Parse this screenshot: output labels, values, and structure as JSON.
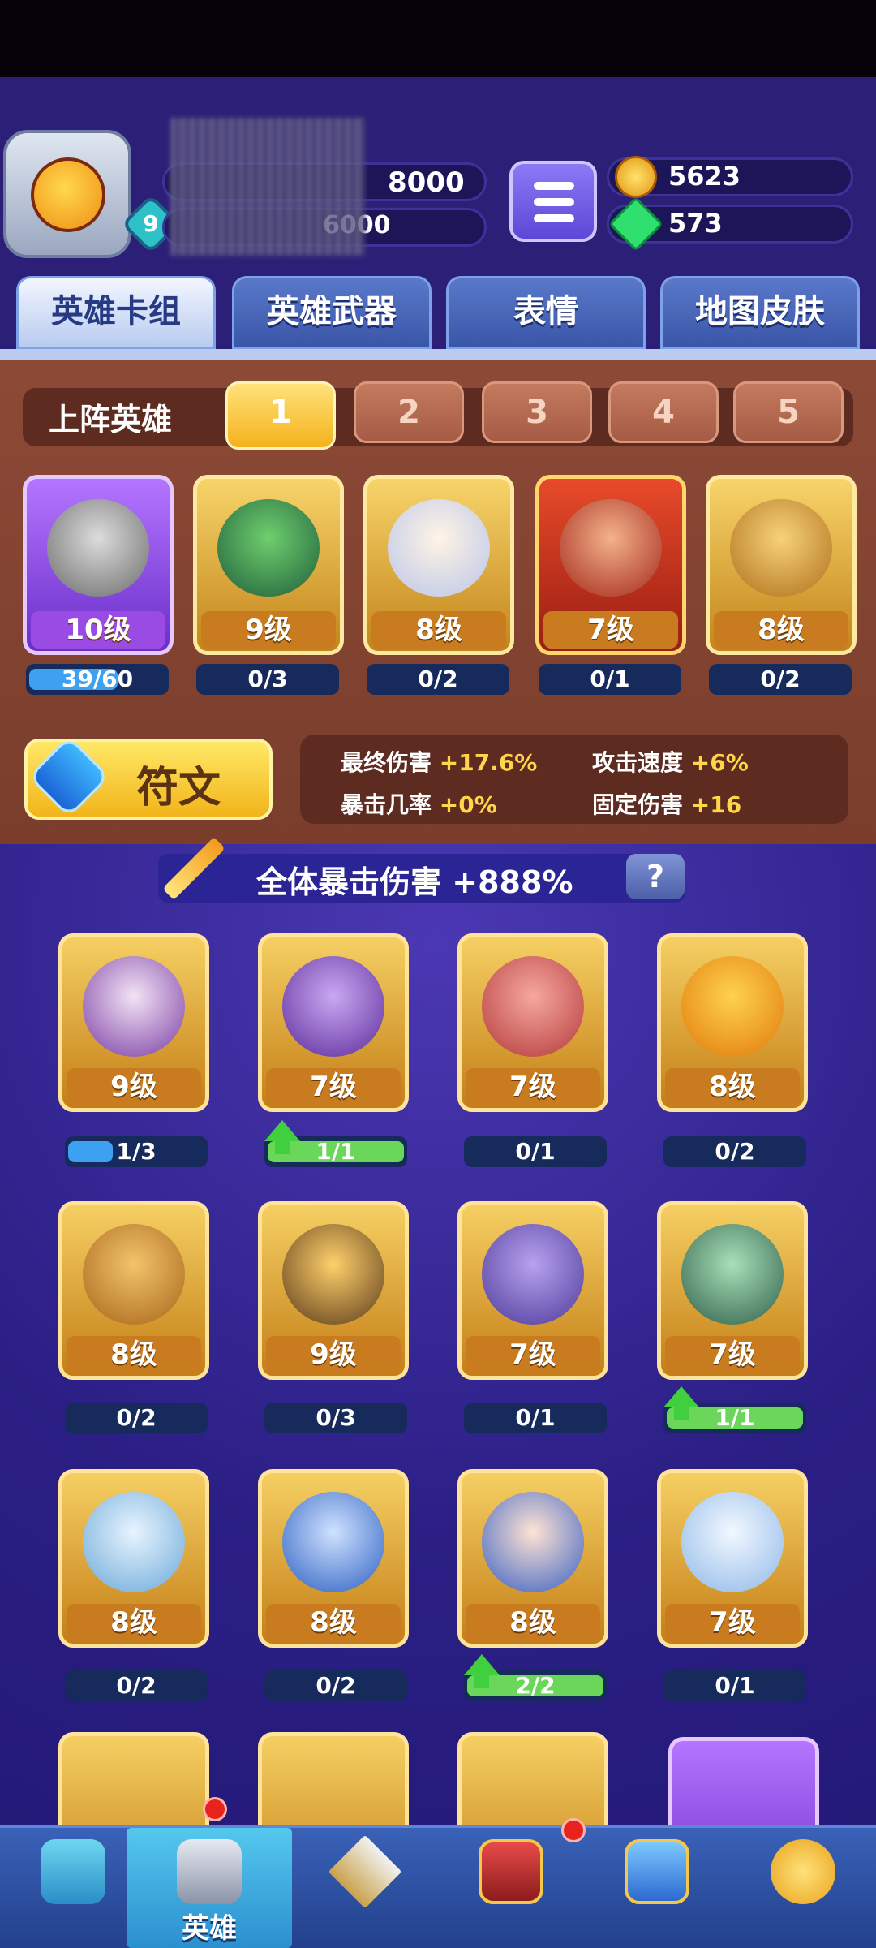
{
  "header": {
    "trophies": "8000",
    "exp": "6000",
    "player_level": "9",
    "coins": "5623",
    "gems": "573"
  },
  "tabs": [
    "英雄卡组",
    "英雄武器",
    "表情",
    "地图皮肤"
  ],
  "lineup": {
    "title": "上阵英雄",
    "slots": [
      "1",
      "2",
      "3",
      "4",
      "5"
    ],
    "active_slot": "1",
    "cards": [
      {
        "level": "10级",
        "progress": "39/60",
        "fill": 0.65
      },
      {
        "level": "9级",
        "progress": "0/3",
        "fill": 0
      },
      {
        "level": "8级",
        "progress": "0/2",
        "fill": 0
      },
      {
        "level": "7级",
        "progress": "0/1",
        "fill": 0
      },
      {
        "level": "8级",
        "progress": "0/2",
        "fill": 0
      }
    ]
  },
  "rune": {
    "label": "符文"
  },
  "stats": {
    "final_damage_label": "最终伤害",
    "final_damage_value": "+17.6%",
    "attack_speed_label": "攻击速度",
    "attack_speed_value": "+6%",
    "crit_rate_label": "暴击几率",
    "crit_rate_value": "+0%",
    "fixed_damage_label": "固定伤害",
    "fixed_damage_value": "+16"
  },
  "crit_banner": {
    "text": "全体暴击伤害 +888%",
    "help": "?"
  },
  "heroes": [
    {
      "level": "9级",
      "progress": "1/3",
      "fill": 0.33,
      "up": false
    },
    {
      "level": "7级",
      "progress": "1/1",
      "fill": 1.0,
      "up": true
    },
    {
      "level": "7级",
      "progress": "0/1",
      "fill": 0,
      "up": false
    },
    {
      "level": "8级",
      "progress": "0/2",
      "fill": 0,
      "up": false
    },
    {
      "level": "8级",
      "progress": "0/2",
      "fill": 0,
      "up": false
    },
    {
      "level": "9级",
      "progress": "0/3",
      "fill": 0,
      "up": false
    },
    {
      "level": "7级",
      "progress": "0/1",
      "fill": 0,
      "up": false
    },
    {
      "level": "7级",
      "progress": "1/1",
      "fill": 1.0,
      "up": true
    },
    {
      "level": "8级",
      "progress": "0/2",
      "fill": 0,
      "up": false
    },
    {
      "level": "8级",
      "progress": "0/2",
      "fill": 0,
      "up": false
    },
    {
      "level": "8级",
      "progress": "2/2",
      "fill": 1.0,
      "up": true
    },
    {
      "level": "7级",
      "progress": "0/1",
      "fill": 0,
      "up": false
    }
  ],
  "nav": {
    "hero_label": "英雄"
  },
  "colors": {
    "accent_gold": "#f4b21c",
    "bg_purple": "#2c1f78",
    "lineup_brown": "#8c4a36"
  }
}
